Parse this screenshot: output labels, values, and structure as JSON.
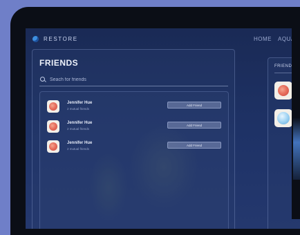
{
  "nav": {
    "brand": "RESTORE",
    "items": [
      "HOME",
      "AQUA"
    ]
  },
  "friends": {
    "title": "FRIENDS",
    "search_placeholder": "Seach for friends",
    "list": [
      {
        "name": "Jennifer Hue",
        "mutual": "2 mutual friends",
        "button": "Add Friend"
      },
      {
        "name": "Jennifer Hue",
        "mutual": "2 mutual friends",
        "button": "Add Friend"
      },
      {
        "name": "Jennifer Hue",
        "mutual": "2 mutual friends",
        "button": "Add Friend"
      }
    ]
  },
  "side": {
    "title": "FRIEND"
  },
  "icons": {
    "brand": "restore-logo-icon",
    "search": "search-icon",
    "avatar": "flower-avatar-icon",
    "side_avatar_2": "bubble-avatar-icon"
  },
  "colors": {
    "background": "#6f7fc8",
    "screen": "#1e3266",
    "accent": "#3d8fe0"
  }
}
